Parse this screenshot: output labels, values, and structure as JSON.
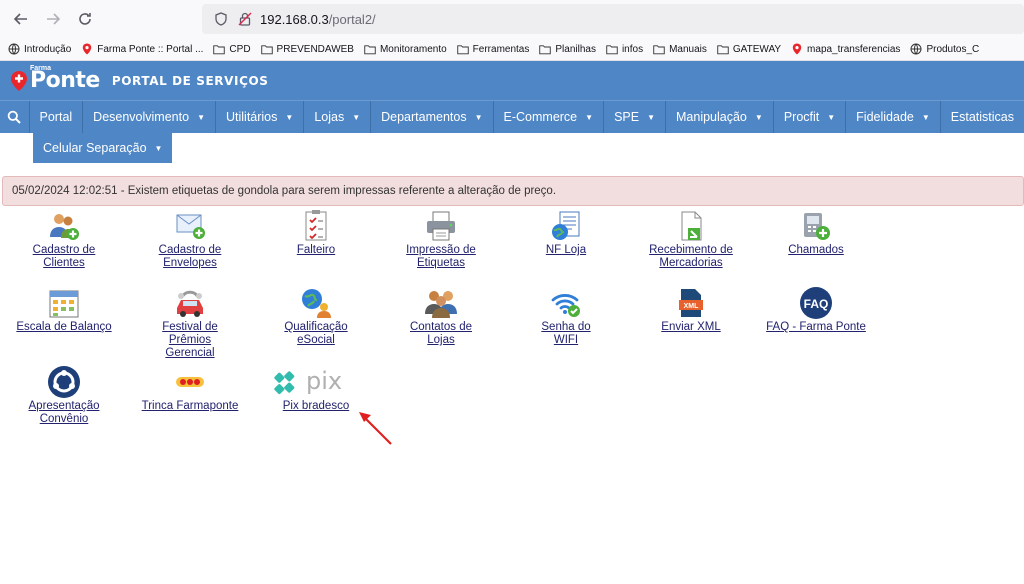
{
  "browser": {
    "url_host": "192.168.0.3",
    "url_path": "/portal2/"
  },
  "bookmarks": [
    {
      "label": "Introdução",
      "icon": "globe-icon"
    },
    {
      "label": "Farma Ponte :: Portal ...",
      "icon": "pin-icon"
    },
    {
      "label": "CPD",
      "icon": "folder-icon"
    },
    {
      "label": "PREVENDAWEB",
      "icon": "folder-icon"
    },
    {
      "label": "Monitoramento",
      "icon": "folder-icon"
    },
    {
      "label": "Ferramentas",
      "icon": "folder-icon"
    },
    {
      "label": "Planilhas",
      "icon": "folder-icon"
    },
    {
      "label": "infos",
      "icon": "folder-icon"
    },
    {
      "label": "Manuais",
      "icon": "folder-icon"
    },
    {
      "label": "GATEWAY",
      "icon": "folder-icon"
    },
    {
      "label": "mapa_transferencias",
      "icon": "pin-icon"
    },
    {
      "label": "Produtos_C",
      "icon": "globe-icon"
    }
  ],
  "header": {
    "logo_small": "Farma",
    "logo_main": "Ponte",
    "title": "PORTAL DE SERVIÇOS"
  },
  "menu": {
    "items": [
      {
        "label": "Portal",
        "dropdown": false
      },
      {
        "label": "Desenvolvimento",
        "dropdown": true
      },
      {
        "label": "Utilitários",
        "dropdown": true
      },
      {
        "label": "Lojas",
        "dropdown": true
      },
      {
        "label": "Departamentos",
        "dropdown": true
      },
      {
        "label": "E-Commerce",
        "dropdown": true
      },
      {
        "label": "SPE",
        "dropdown": true
      },
      {
        "label": "Manipulação",
        "dropdown": true
      },
      {
        "label": "Procfit",
        "dropdown": true
      },
      {
        "label": "Fidelidade",
        "dropdown": true
      },
      {
        "label": "Estatisticas",
        "dropdown": false
      }
    ],
    "row2": {
      "label": "Celular Separação",
      "dropdown": true
    }
  },
  "alert": {
    "text": "05/02/2024 12:02:51 - Existem etiquetas de gondola para serem impressas referente a alteração de preço."
  },
  "tiles": [
    {
      "label": [
        "Cadastro de",
        "Clientes"
      ],
      "icon": "users-add-icon"
    },
    {
      "label": [
        "Cadastro de",
        "Envelopes"
      ],
      "icon": "envelope-add-icon"
    },
    {
      "label": [
        "Falteiro"
      ],
      "icon": "checklist-icon"
    },
    {
      "label": [
        "Impressão de",
        "Etiquetas"
      ],
      "icon": "printer-icon"
    },
    {
      "label": [
        "NF Loja"
      ],
      "icon": "invoice-globe-icon"
    },
    {
      "label": [
        "Recebimento de",
        "Mercadorias"
      ],
      "icon": "document-receive-icon"
    },
    {
      "label": [
        "Chamados"
      ],
      "icon": "phone-ticket-icon"
    },
    {
      "label": [
        "Escala de Balanço"
      ],
      "icon": "calendar-icon"
    },
    {
      "label": [
        "Festival de",
        "Prêmios",
        "Gerencial"
      ],
      "icon": "car-icon"
    },
    {
      "label": [
        "Qualificação",
        "eSocial"
      ],
      "icon": "globe-person-icon"
    },
    {
      "label": [
        "Contatos de",
        "Lojas"
      ],
      "icon": "contacts-icon"
    },
    {
      "label": [
        "Senha do",
        "WIFI"
      ],
      "icon": "wifi-check-icon"
    },
    {
      "label": [
        "Enviar XML"
      ],
      "icon": "xml-icon"
    },
    {
      "label": [
        "FAQ - Farma Ponte"
      ],
      "icon": "faq-icon"
    },
    {
      "label": [
        "Apresentação",
        "Convênio"
      ],
      "icon": "convenio-icon"
    },
    {
      "label": [
        "Trinca Farmaponte"
      ],
      "icon": "trinca-icon"
    },
    {
      "label": [
        "Pix bradesco"
      ],
      "icon": "pix-logo-icon",
      "logo_text": "pix"
    }
  ],
  "colors": {
    "header_blue": "#4f86c6",
    "alert_bg": "#f2dede",
    "link": "#22226e",
    "arrow_red": "#e02020"
  }
}
